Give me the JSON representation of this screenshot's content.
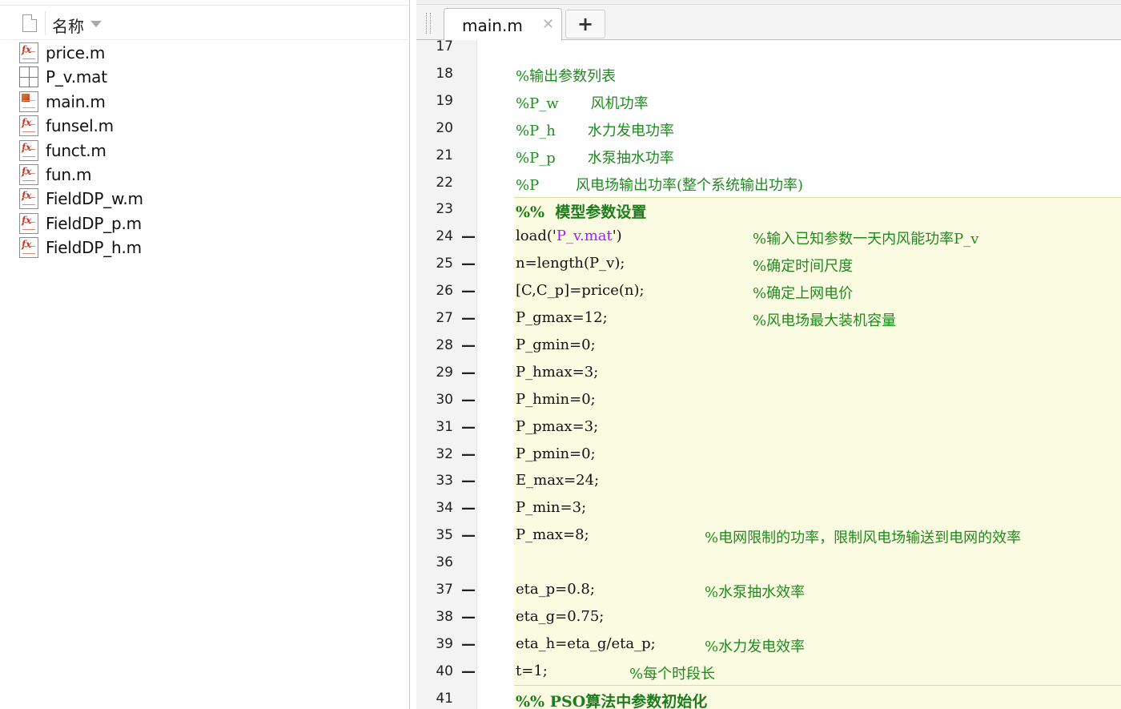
{
  "file_browser": {
    "column_header": "名称",
    "files": [
      {
        "name": "price.m",
        "icon": "function-file-icon"
      },
      {
        "name": "P_v.mat",
        "icon": "mat-file-icon"
      },
      {
        "name": "main.m",
        "icon": "script-file-icon"
      },
      {
        "name": "funsel.m",
        "icon": "function-file-icon"
      },
      {
        "name": "funct.m",
        "icon": "function-file-icon"
      },
      {
        "name": "fun.m",
        "icon": "function-file-icon"
      },
      {
        "name": "FieldDP_w.m",
        "icon": "function-file-icon"
      },
      {
        "name": "FieldDP_p.m",
        "icon": "function-file-icon"
      },
      {
        "name": "FieldDP_h.m",
        "icon": "function-file-icon"
      }
    ]
  },
  "editor": {
    "tab_label": "main.m",
    "tab_close": "✕",
    "add_tab": "+",
    "lines": [
      {
        "n": "17",
        "dash": false,
        "code": "",
        "comment": ""
      },
      {
        "n": "18",
        "dash": false,
        "code": "",
        "comment": "%输出参数列表"
      },
      {
        "n": "19",
        "dash": false,
        "code": "",
        "comment": "%P_w       风机功率"
      },
      {
        "n": "20",
        "dash": false,
        "code": "",
        "comment": "%P_h       水力发电功率"
      },
      {
        "n": "21",
        "dash": false,
        "code": "",
        "comment": "%P_p       水泵抽水功率"
      },
      {
        "n": "22",
        "dash": false,
        "code": "",
        "comment": "%P        风电场输出功率(整个系统输出功率)"
      },
      {
        "n": "23",
        "dash": false,
        "cell": "%%  模型参数设置"
      },
      {
        "n": "24",
        "dash": true,
        "code_pre": "load('",
        "code_str": "P_v.mat",
        "code_post": "')",
        "comment": "%输入已知参数一天内风能功率P_v"
      },
      {
        "n": "25",
        "dash": true,
        "code": "n=length(P_v);",
        "comment": "%确定时间尺度"
      },
      {
        "n": "26",
        "dash": true,
        "code": "[C,C_p]=price(n);",
        "comment": "%确定上网电价"
      },
      {
        "n": "27",
        "dash": true,
        "code": "P_gmax=12;",
        "comment": "%风电场最大装机容量"
      },
      {
        "n": "28",
        "dash": true,
        "code": "P_gmin=0;",
        "comment": ""
      },
      {
        "n": "29",
        "dash": true,
        "code": "P_hmax=3;",
        "comment": ""
      },
      {
        "n": "30",
        "dash": true,
        "code": "P_hmin=0;",
        "comment": ""
      },
      {
        "n": "31",
        "dash": true,
        "code": "P_pmax=3;",
        "comment": ""
      },
      {
        "n": "32",
        "dash": true,
        "code": "P_pmin=0;",
        "comment": ""
      },
      {
        "n": "33",
        "dash": true,
        "code": "E_max=24;",
        "comment": ""
      },
      {
        "n": "34",
        "dash": true,
        "code": "P_min=3;",
        "comment": ""
      },
      {
        "n": "35",
        "dash": true,
        "code": "P_max=8;",
        "comment": "%电网限制的功率，限制风电场输送到电网的效率"
      },
      {
        "n": "36",
        "dash": false,
        "code": "",
        "comment": ""
      },
      {
        "n": "37",
        "dash": true,
        "code": "eta_p=0.8;",
        "comment": "%水泵抽水效率"
      },
      {
        "n": "38",
        "dash": true,
        "code": "eta_g=0.75;",
        "comment": ""
      },
      {
        "n": "39",
        "dash": true,
        "code": "eta_h=eta_g/eta_p;",
        "comment": "%水力发电效率"
      },
      {
        "n": "40",
        "dash": true,
        "code": "t=1;",
        "comment": "%每个时段长"
      },
      {
        "n": "41",
        "dash": false,
        "cell": "%% PSO算法中参数初始化"
      }
    ]
  }
}
